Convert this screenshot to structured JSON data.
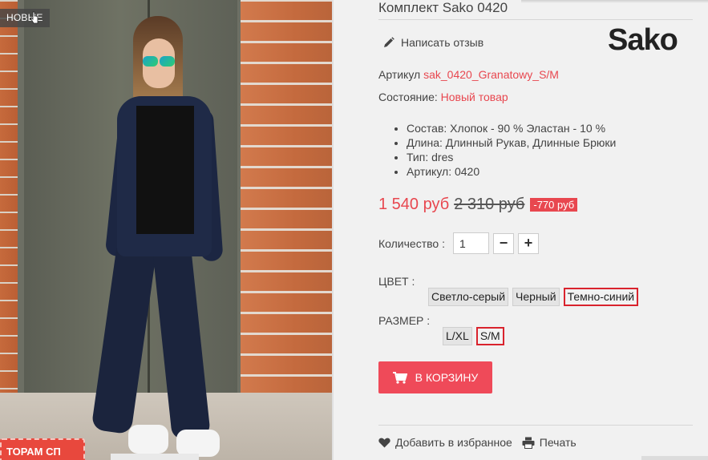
{
  "photo": {
    "badge": "НОВЫЕ",
    "promo_text": "ТОРАМ СП"
  },
  "product": {
    "title": "Комплект Sako 0420",
    "review_link": "Написать отзыв",
    "brand_logo": "Sako",
    "sku_label": "Артикул",
    "sku_value": "sak_0420_Granatowy_S/M",
    "condition_label": "Состояние:",
    "condition_value": "Новый товар",
    "properties": [
      "Состав: Хлопок - 90 % Эластан - 10 %",
      "Длина: Длинный Рукав, Длинные Брюки",
      "Тип: dres",
      "Артикул: 0420"
    ]
  },
  "price": {
    "current": "1 540 руб",
    "old": "2 310 руб",
    "discount": "-770 руб"
  },
  "quantity": {
    "label": "Количество :",
    "value": "1",
    "minus": "−",
    "plus": "+"
  },
  "color": {
    "label": "ЦВЕТ :",
    "options": [
      "Светло-серый",
      "Черный",
      "Темно-синий"
    ],
    "selected": "Темно-синий"
  },
  "size": {
    "label": "РАЗМЕР :",
    "options": [
      "L/XL",
      "S/M"
    ],
    "selected": "S/M"
  },
  "cart": {
    "label": "В КОРЗИНУ"
  },
  "actions": {
    "favorite": "Добавить в избранное",
    "print": "Печать"
  },
  "colors": {
    "accent": "#e8474f",
    "cart_button": "#ef4a59",
    "selected_border": "#d9232d"
  },
  "icons": {
    "review": "pencil-icon",
    "cart": "cart-icon",
    "favorite": "heart-icon",
    "print": "printer-icon"
  }
}
